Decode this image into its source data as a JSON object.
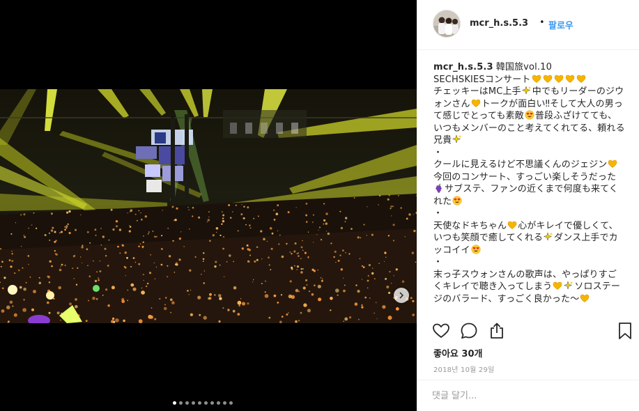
{
  "post": {
    "username": "mcr_h.s.5.3",
    "separator": "•",
    "follow_label": "팔로우"
  },
  "caption": {
    "username": "mcr_h.s.5.3",
    "line1": "韓国旅vol.10",
    "line2": "SECHSKIESコンサート",
    "p1a": "チェッキーはMC上手",
    "p1b": "中でもリーダーのジウォンさん",
    "p1c": "トークが面白い‼そして大人の男って感じでとっても素敵",
    "p1d": "普段ふざけてても、いつもメンバーのこと考えてくれてる、頼れる兄貴",
    "dot1": "・",
    "p2a": "クールに見えるけど不思議くんのジェジン",
    "p2b": "今回のコンサート、すっごい楽しそうだった",
    "p2c": "サブステ、ファンの近くまで何度も来てくれた",
    "dot2": "・",
    "p3a": "天使なドキちゃん",
    "p3b": "心がキレイで優しくて、いつも笑顔で癒してくれる",
    "p3c": "ダンス上手でカッコイイ",
    "dot3": "・",
    "p4a": "末っ子スウォンさんの歌声は、やっぱりすごくキレイで聴き入ってしまう",
    "p4b": "ソロステージのバラード、すっごく良かった～"
  },
  "icons": {
    "heart": "heart-icon",
    "comment": "comment-icon",
    "share": "share-icon",
    "bookmark": "bookmark-icon",
    "next": "chevron-right-icon"
  },
  "likes_label": "좋아요 30개",
  "date_label": "2018년 10월 29일",
  "comment_placeholder": "댓글 달기...",
  "carousel": {
    "total_slides": 10,
    "active_slide": 1
  },
  "colors": {
    "accent": "#3897f0",
    "emoji_heart": "#f7b500",
    "text": "#262626",
    "muted": "#999999"
  }
}
